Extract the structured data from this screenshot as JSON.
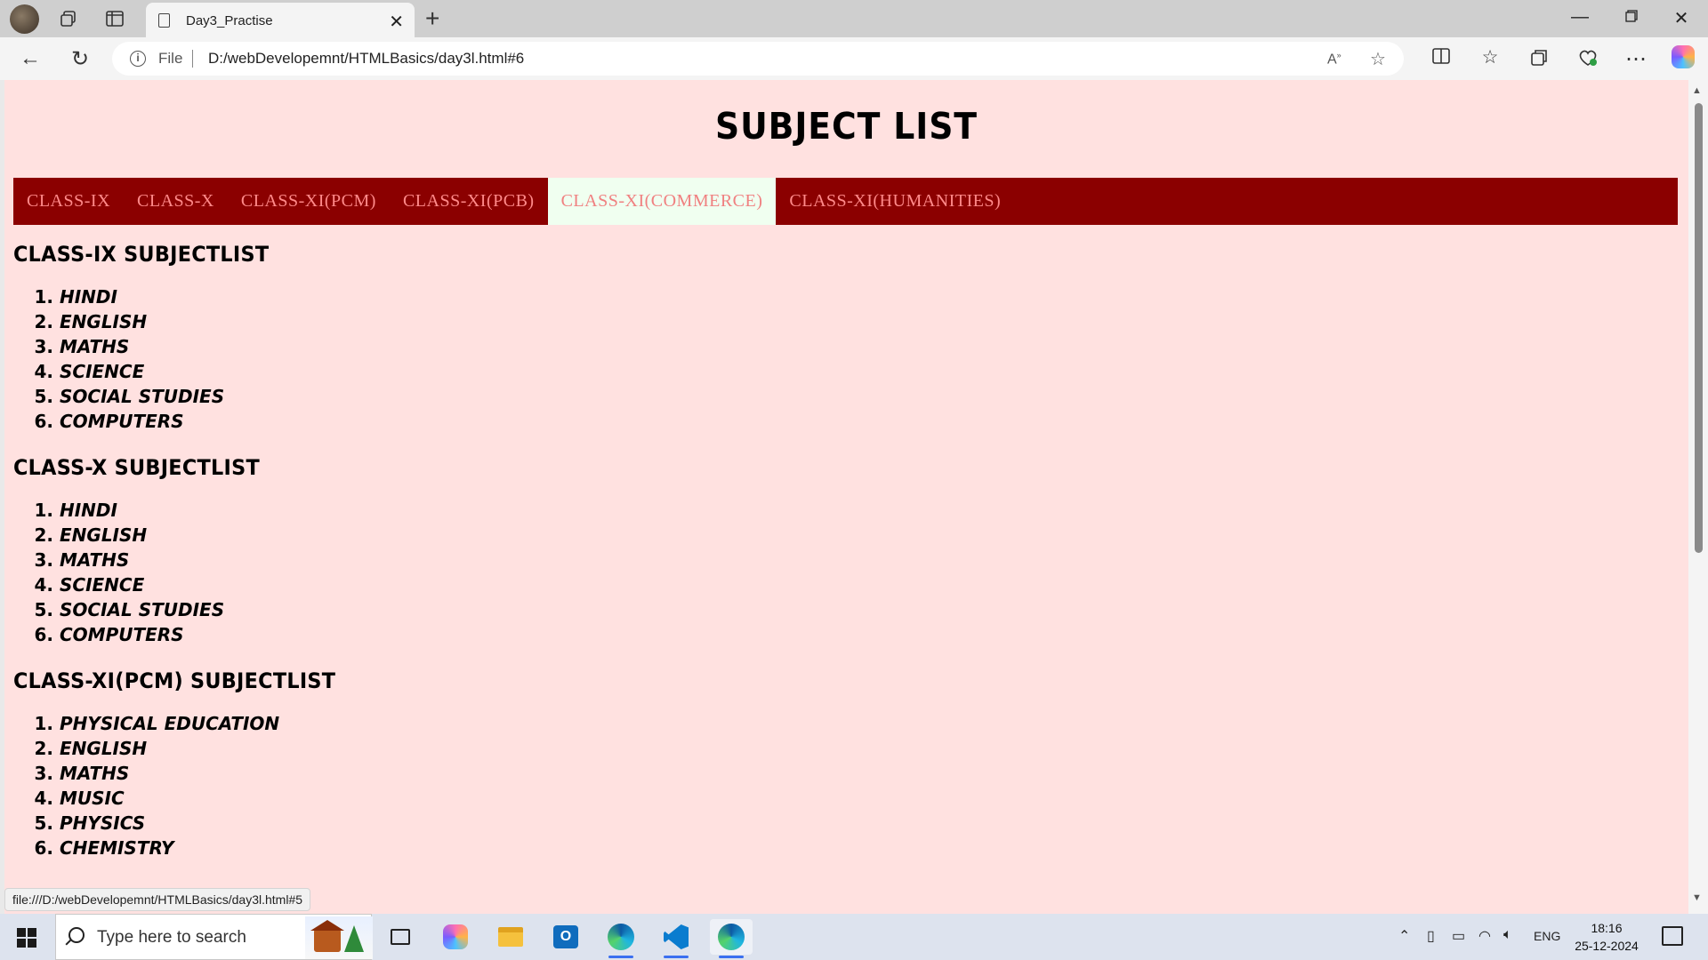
{
  "browser": {
    "tab_title": "Day3_Practise",
    "address_scheme_label": "File",
    "address_url": "D:/webDevelopemnt/HTMLBasics/day3l.html#6",
    "status_link": "file:///D:/webDevelopemnt/HTMLBasics/day3l.html#5",
    "new_tab_symbol": "+",
    "close_tab_symbol": "✕"
  },
  "page": {
    "title": "SUBJECT LIST",
    "nav": [
      {
        "label": "CLASS-IX",
        "active": false
      },
      {
        "label": "CLASS-X",
        "active": false
      },
      {
        "label": "CLASS-XI(PCM)",
        "active": false
      },
      {
        "label": "CLASS-XI(PCB)",
        "active": false
      },
      {
        "label": "CLASS-XI(COMMERCE)",
        "active": true
      },
      {
        "label": "CLASS-XI(HUMANITIES)",
        "active": false
      }
    ],
    "sections": [
      {
        "title": "CLASS-IX SUBJECTLIST",
        "subjects": [
          "HINDI",
          "ENGLISH",
          "MATHS",
          "SCIENCE",
          "SOCIAL STUDIES",
          "COMPUTERS"
        ]
      },
      {
        "title": "CLASS-X SUBJECTLIST",
        "subjects": [
          "HINDI",
          "ENGLISH",
          "MATHS",
          "SCIENCE",
          "SOCIAL STUDIES",
          "COMPUTERS"
        ]
      },
      {
        "title": "CLASS-XI(PCM) SUBJECTLIST",
        "subjects": [
          "PHYSICAL EDUCATION",
          "ENGLISH",
          "MATHS",
          "MUSIC",
          "PHYSICS",
          "CHEMISTRY"
        ]
      }
    ],
    "colors": {
      "background": "#ffe1e0",
      "navbar": "#8b0000",
      "nav_text": "#ff8a8a",
      "nav_active_bg": "#f0fff0"
    }
  },
  "taskbar": {
    "search_placeholder": "Type here to search",
    "language": "ENG",
    "time": "18:16",
    "date": "25-12-2024",
    "apps": [
      "task-view",
      "copilot",
      "file-explorer",
      "outlook",
      "edge",
      "vscode",
      "edge-active"
    ]
  }
}
